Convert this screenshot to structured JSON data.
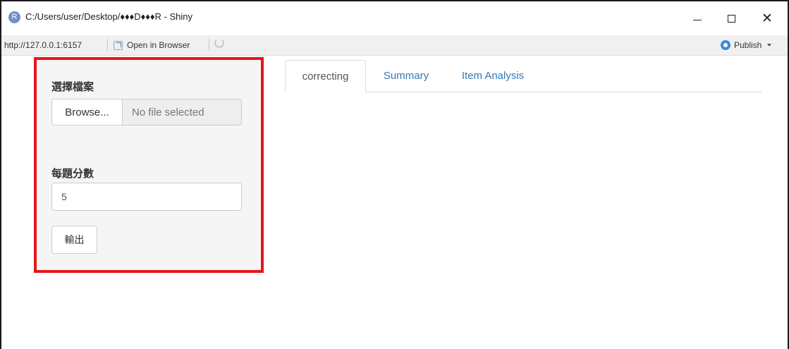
{
  "window": {
    "title": "C:/Users/user/Desktop/♦♦♦D♦♦♦R - Shiny",
    "app_icon_letter": "R",
    "minimize_icon": "minimize-icon",
    "maximize_icon": "maximize-icon",
    "close_icon": "close-icon",
    "close_glyph": "✕"
  },
  "toolbar": {
    "url": "http://127.0.0.1:6157",
    "open_in_browser_label": "Open in Browser",
    "publish_label": "Publish"
  },
  "sidebar": {
    "file_label": "選擇檔案",
    "browse_label": "Browse...",
    "file_placeholder": "No file selected",
    "score_label": "每題分數",
    "score_value": "5",
    "output_label": "輸出"
  },
  "tabs": [
    {
      "label": "correcting",
      "active": true
    },
    {
      "label": "Summary",
      "active": false
    },
    {
      "label": "Item Analysis",
      "active": false
    }
  ],
  "colors": {
    "highlight_border": "#e5151b",
    "tab_link": "#337ab7",
    "sidebar_bg": "#f5f5f5"
  }
}
